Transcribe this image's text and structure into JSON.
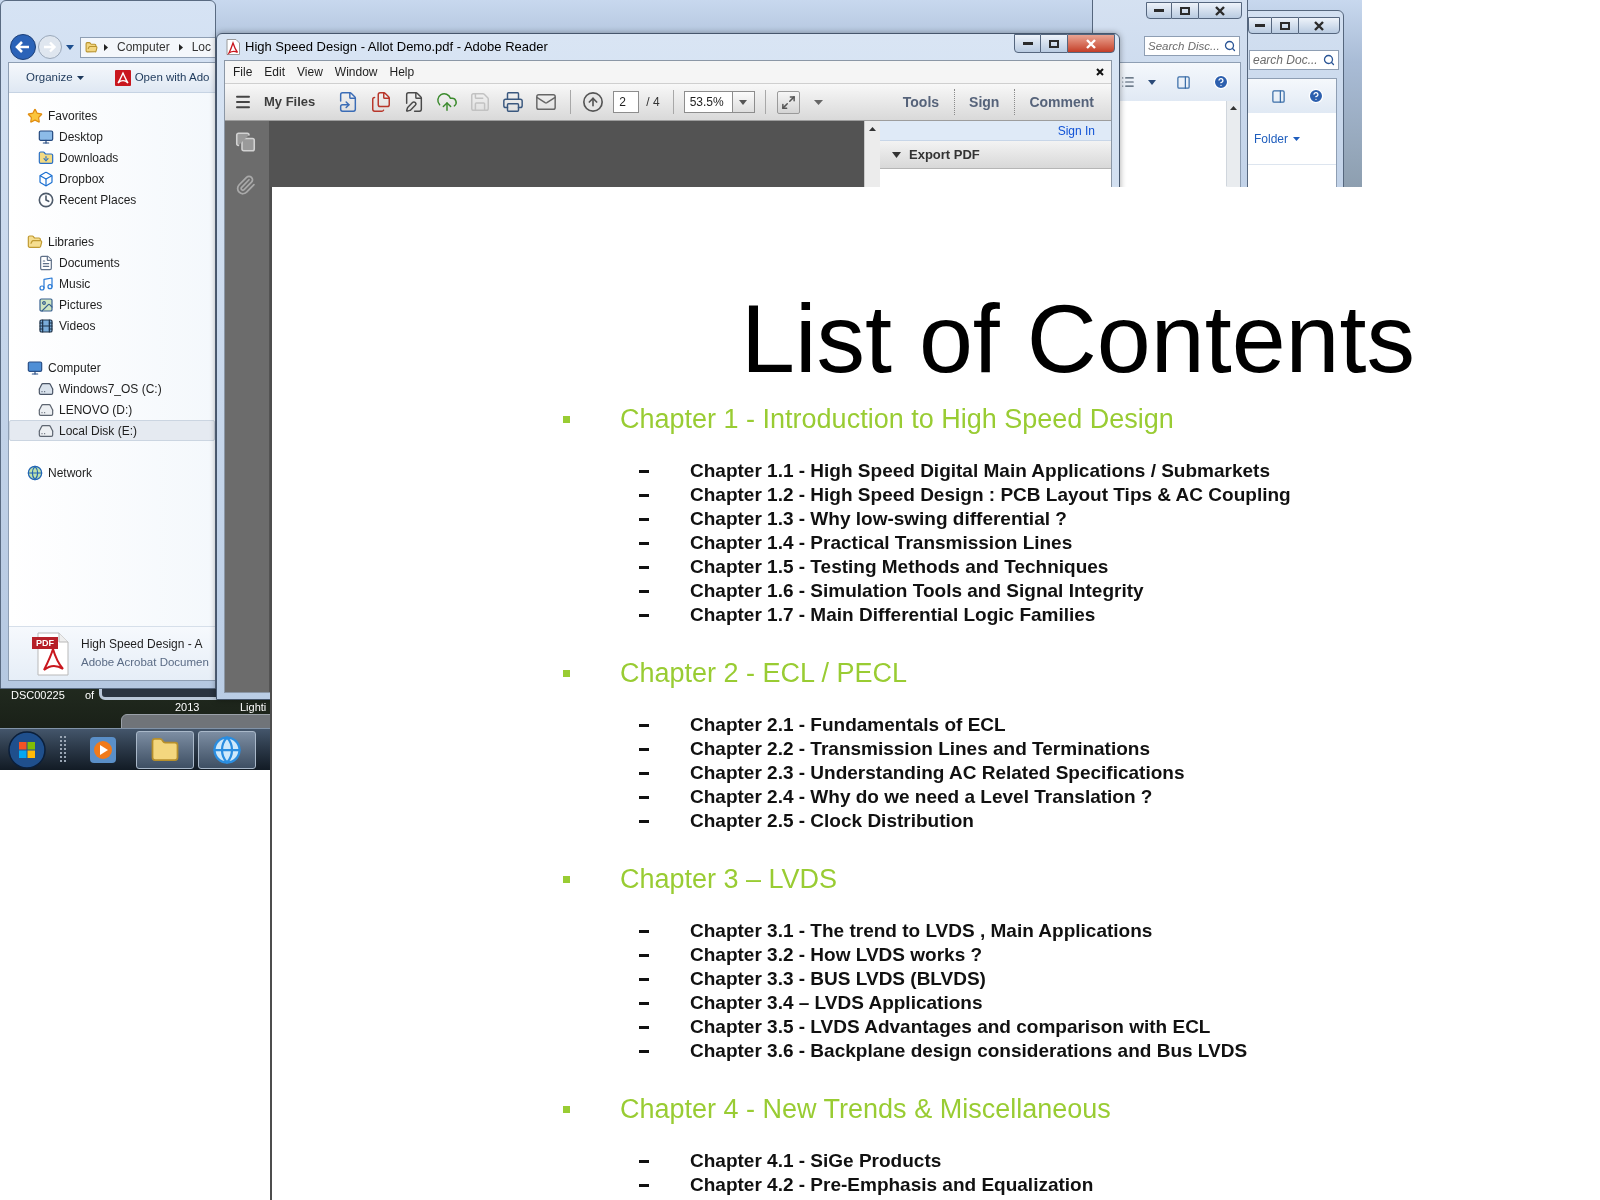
{
  "desktop": {
    "labels": [
      "DSC00225",
      "of",
      "2013",
      "Lighti"
    ]
  },
  "explorer": {
    "address": [
      "Computer",
      "Loc"
    ],
    "commands": [
      {
        "label": "Organize",
        "kind": "menu"
      },
      {
        "label": "Open with Ado",
        "kind": "app"
      }
    ],
    "nav": [
      {
        "label": "Favorites",
        "kind": "star",
        "selected": false,
        "children": [
          {
            "label": "Desktop",
            "kind": "desktop",
            "selected": false
          },
          {
            "label": "Downloads",
            "kind": "downloads",
            "selected": false
          },
          {
            "label": "Dropbox",
            "kind": "dropbox",
            "selected": false
          },
          {
            "label": "Recent Places",
            "kind": "recent",
            "selected": false
          }
        ]
      },
      {
        "label": "Libraries",
        "kind": "library",
        "selected": false,
        "children": [
          {
            "label": "Documents",
            "kind": "documents",
            "selected": false
          },
          {
            "label": "Music",
            "kind": "music",
            "selected": false
          },
          {
            "label": "Pictures",
            "kind": "pictures",
            "selected": false
          },
          {
            "label": "Videos",
            "kind": "videos",
            "selected": false
          }
        ]
      },
      {
        "label": "Computer",
        "kind": "computer",
        "selected": false,
        "children": [
          {
            "label": "Windows7_OS (C:)",
            "kind": "system",
            "selected": false
          },
          {
            "label": "LENOVO (D:)",
            "kind": "drive",
            "selected": false
          },
          {
            "label": "Local Disk (E:)",
            "kind": "drive",
            "selected": true
          }
        ]
      },
      {
        "label": "Network",
        "kind": "network",
        "selected": false
      }
    ],
    "details": {
      "badge": "PDF",
      "name": "High Speed Design - A",
      "type": "Adobe Acrobat Documen"
    }
  },
  "reader": {
    "title": "High Speed Design - Allot Demo.pdf - Adobe Reader",
    "active": true,
    "menu": [
      "File",
      "Edit",
      "View",
      "Window",
      "Help"
    ],
    "toolbar": {
      "label": "My Files",
      "tools": [
        {
          "kind": "create",
          "disabled": false
        },
        {
          "kind": "combine",
          "disabled": false
        },
        {
          "kind": "edit",
          "disabled": false
        },
        {
          "kind": "upload",
          "disabled": false
        },
        {
          "kind": "save",
          "disabled": true
        },
        {
          "kind": "print",
          "disabled": false
        },
        {
          "kind": "email",
          "disabled": false
        }
      ],
      "page": "2",
      "page_total": "/ 4",
      "zoom": "53.5%",
      "panes": [
        "Tools",
        "Sign",
        "Comment"
      ]
    },
    "side_pane": {
      "link": "Sign In",
      "section": "Export PDF",
      "expanded": true
    }
  },
  "back_windows": [
    {
      "active": false,
      "search_placeholder": "Search Disc..."
    },
    {
      "active": false,
      "search_placeholder": "earch Doc...",
      "menu": "Folder"
    }
  ],
  "taskbar": [
    {
      "kind": "media",
      "running": false
    },
    {
      "kind": "explorer",
      "running": true
    },
    {
      "kind": "browser",
      "running": true
    }
  ],
  "document": {
    "title": "List of Contents",
    "chapters": [
      {
        "heading": "Chapter 1 - Introduction to High Speed Design",
        "sections": [
          "Chapter 1.1 - High Speed Digital Main Applications / Submarkets",
          "Chapter 1.2 - High Speed Design : PCB Layout Tips & AC Coupling",
          "Chapter 1.3 - Why low-swing differential ?",
          "Chapter 1.4 - Practical Transmission Lines",
          "Chapter 1.5 - Testing Methods and Techniques",
          "Chapter 1.6 - Simulation Tools and Signal Integrity",
          "Chapter 1.7 - Main Differential Logic Families"
        ]
      },
      {
        "heading": "Chapter 2 - ECL / PECL",
        "sections": [
          "Chapter 2.1 - Fundamentals of ECL",
          "Chapter 2.2 - Transmission Lines and Terminations",
          "Chapter 2.3 - Understanding AC Related Specifications",
          "Chapter 2.4 - Why do we need a Level Translation ?",
          "Chapter 2.5 - Clock Distribution"
        ]
      },
      {
        "heading": "Chapter 3 – LVDS",
        "sections": [
          "Chapter 3.1 - The trend to LVDS , Main Applications",
          "Chapter 3.2 - How LVDS works ?",
          "Chapter 3.3 - BUS LVDS (BLVDS)",
          "Chapter 3.4 – LVDS Applications",
          "Chapter 3.5 - LVDS Advantages and comparison with ECL",
          "Chapter 3.6 - Backplane design considerations and Bus LVDS"
        ]
      },
      {
        "heading": "Chapter 4 - New Trends & Miscellaneous",
        "sections": [
          "Chapter 4.1 - SiGe Products",
          "Chapter 4.2 - Pre-Emphasis and Equalization"
        ]
      }
    ]
  }
}
